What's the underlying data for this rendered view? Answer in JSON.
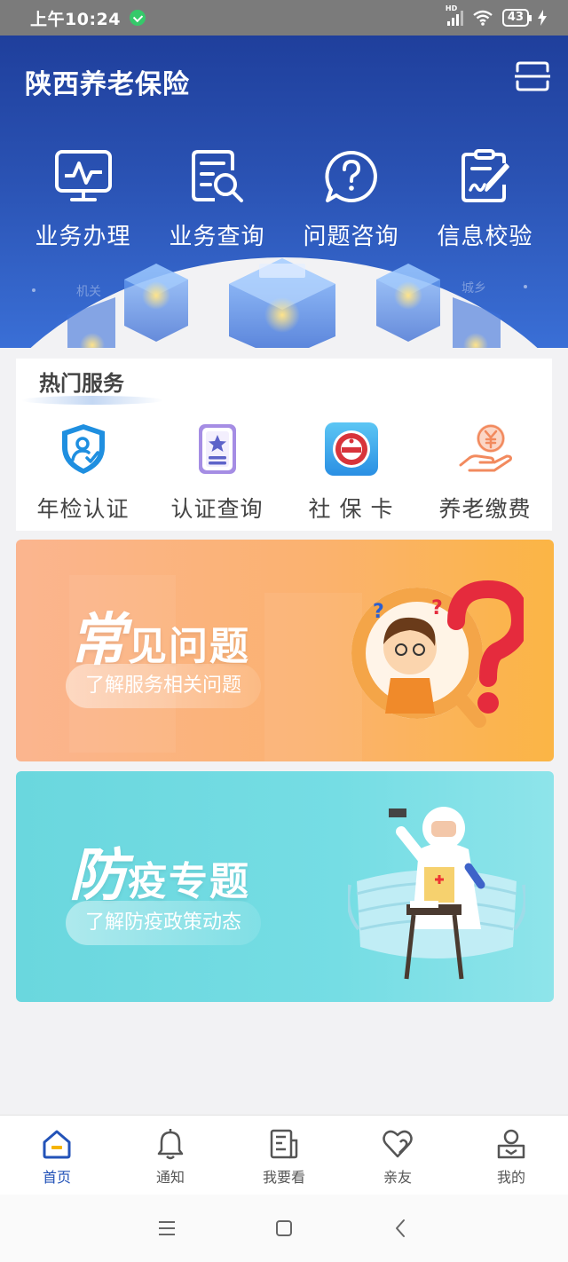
{
  "status_bar": {
    "time": "上午10:24",
    "network": "HD",
    "battery": "43"
  },
  "header": {
    "title": "陕西养老保险",
    "main_nav": [
      {
        "label": "业务办理",
        "icon": "monitor-icon"
      },
      {
        "label": "业务查询",
        "icon": "document-search-icon"
      },
      {
        "label": "问题咨询",
        "icon": "question-chat-icon"
      },
      {
        "label": "信息校验",
        "icon": "sign-document-icon"
      }
    ],
    "deco_left": "机关",
    "deco_right": "城乡"
  },
  "hot_services": {
    "title": "热门服务",
    "items": [
      {
        "label": "年检认证",
        "icon": "shield-user-icon"
      },
      {
        "label": "认证查询",
        "icon": "certificate-star-icon"
      },
      {
        "label": "社 保 卡",
        "icon": "social-security-card-icon"
      },
      {
        "label": "养老缴费",
        "icon": "yen-payment-icon"
      }
    ]
  },
  "banners": {
    "faq": {
      "title_first": "常",
      "title_rest": "见问题",
      "subtitle": "了解服务相关问题"
    },
    "epidemic": {
      "title_first": "防",
      "title_rest": "疫专题",
      "subtitle": "了解防疫政策动态"
    }
  },
  "tab_bar": {
    "tabs": [
      {
        "label": "首页",
        "icon": "home-icon",
        "active": true
      },
      {
        "label": "通知",
        "icon": "bell-icon",
        "active": false
      },
      {
        "label": "我要看",
        "icon": "news-icon",
        "active": false
      },
      {
        "label": "亲友",
        "icon": "heart-icon",
        "active": false
      },
      {
        "label": "我的",
        "icon": "user-icon",
        "active": false
      }
    ]
  },
  "colors": {
    "brand_blue": "#2353b8",
    "header_dark": "#1f3f9c",
    "faq_orange": "#fbb270",
    "epidemic_cyan": "#75dde4"
  }
}
